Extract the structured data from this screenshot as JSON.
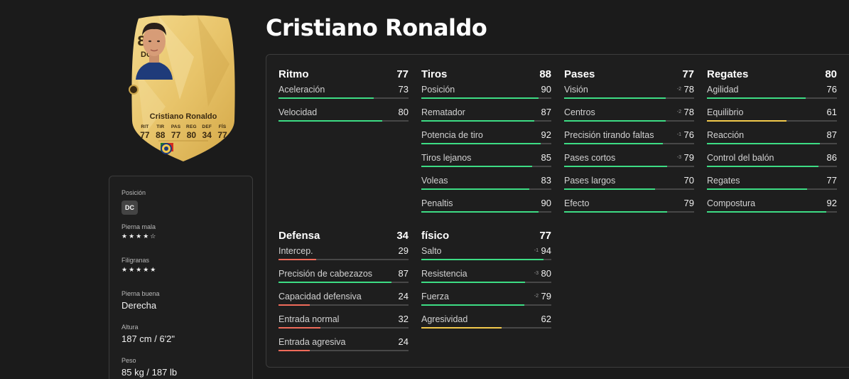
{
  "player": {
    "name": "Cristiano Ronaldo",
    "card": {
      "rating": "86",
      "position": "DC",
      "name": "Cristiano Ronaldo",
      "stats": [
        {
          "key": "RIT",
          "value": "77"
        },
        {
          "key": "TIR",
          "value": "88"
        },
        {
          "key": "PAS",
          "value": "77"
        },
        {
          "key": "REG",
          "value": "80"
        },
        {
          "key": "DEF",
          "value": "34"
        },
        {
          "key": "FÍS",
          "value": "77"
        }
      ],
      "badges": [
        "portugal-flag-icon",
        "league-badge-icon",
        "club-badge-icon"
      ]
    }
  },
  "info": {
    "position": {
      "label": "Posición",
      "value": "DC"
    },
    "weak_foot": {
      "label": "Pierna mala",
      "stars": "★★★★☆",
      "rating": 4
    },
    "skill_moves": {
      "label": "Filigranas",
      "stars": "★★★★★",
      "rating": 5
    },
    "preferred_foot": {
      "label": "Pierna buena",
      "value": "Derecha"
    },
    "height": {
      "label": "Altura",
      "value": "187 cm / 6'2\""
    },
    "weight": {
      "label": "Peso",
      "value": "85 kg / 187 lb"
    }
  },
  "colors": {
    "good": "#3ddc84",
    "average": "#f2c94c",
    "poor": "#ef6b5a",
    "card_gold": "#e8c46a"
  },
  "groups": [
    {
      "name": "Ritmo",
      "value": "77",
      "stats": [
        {
          "label": "Aceleración",
          "value": "73",
          "delta": ""
        },
        {
          "label": "Velocidad",
          "value": "80",
          "delta": ""
        }
      ]
    },
    {
      "name": "Tiros",
      "value": "88",
      "stats": [
        {
          "label": "Posición",
          "value": "90",
          "delta": ""
        },
        {
          "label": "Rematador",
          "value": "87",
          "delta": ""
        },
        {
          "label": "Potencia de tiro",
          "value": "92",
          "delta": ""
        },
        {
          "label": "Tiros lejanos",
          "value": "85",
          "delta": ""
        },
        {
          "label": "Voleas",
          "value": "83",
          "delta": ""
        },
        {
          "label": "Penaltis",
          "value": "90",
          "delta": ""
        }
      ]
    },
    {
      "name": "Pases",
      "value": "77",
      "stats": [
        {
          "label": "Visión",
          "value": "78",
          "delta": "-2"
        },
        {
          "label": "Centros",
          "value": "78",
          "delta": "-2"
        },
        {
          "label": "Precisión tirando faltas",
          "value": "76",
          "delta": "-1"
        },
        {
          "label": "Pases cortos",
          "value": "79",
          "delta": "-3"
        },
        {
          "label": "Pases largos",
          "value": "70",
          "delta": ""
        },
        {
          "label": "Efecto",
          "value": "79",
          "delta": ""
        }
      ]
    },
    {
      "name": "Regates",
      "value": "80",
      "stats": [
        {
          "label": "Agilidad",
          "value": "76",
          "delta": ""
        },
        {
          "label": "Equilibrio",
          "value": "61",
          "delta": ""
        },
        {
          "label": "Reacción",
          "value": "87",
          "delta": ""
        },
        {
          "label": "Control del balón",
          "value": "86",
          "delta": ""
        },
        {
          "label": "Regates",
          "value": "77",
          "delta": ""
        },
        {
          "label": "Compostura",
          "value": "92",
          "delta": ""
        }
      ]
    },
    {
      "name": "Defensa",
      "value": "34",
      "stats": [
        {
          "label": "Intercep.",
          "value": "29",
          "delta": ""
        },
        {
          "label": "Precisión de cabezazos",
          "value": "87",
          "delta": ""
        },
        {
          "label": "Capacidad defensiva",
          "value": "24",
          "delta": ""
        },
        {
          "label": "Entrada normal",
          "value": "32",
          "delta": ""
        },
        {
          "label": "Entrada agresiva",
          "value": "24",
          "delta": ""
        }
      ]
    },
    {
      "name": "físico",
      "value": "77",
      "stats": [
        {
          "label": "Salto",
          "value": "94",
          "delta": "-1"
        },
        {
          "label": "Resistencia",
          "value": "80",
          "delta": "-3"
        },
        {
          "label": "Fuerza",
          "value": "79",
          "delta": "-2"
        },
        {
          "label": "Agresividad",
          "value": "62",
          "delta": ""
        }
      ]
    }
  ]
}
